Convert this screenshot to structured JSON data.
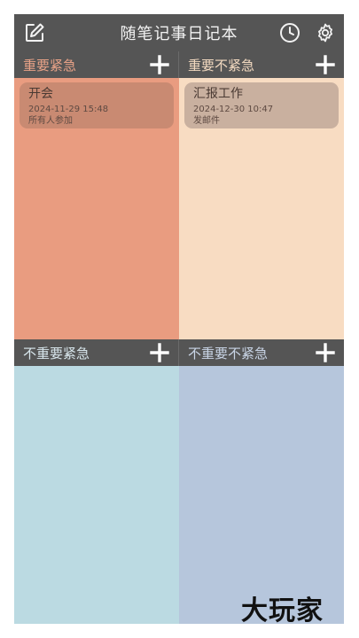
{
  "header": {
    "title": "随笔记事日记本",
    "left_icon": "edit-icon",
    "right_icons": [
      "clock-icon",
      "gear-icon"
    ]
  },
  "quadrants": [
    {
      "title": "重要紧急",
      "bg": "#e99c80",
      "title_color": "#e8a287",
      "cards": [
        {
          "title": "开会",
          "time": "2024-11-29 15:48",
          "note": "所有人参加",
          "bg": "#c98a72"
        }
      ]
    },
    {
      "title": "重要不紧急",
      "bg": "#f8dcc2",
      "title_color": "#f2d9c0",
      "cards": [
        {
          "title": "汇报工作",
          "time": "2024-12-30 10:47",
          "note": "发邮件",
          "bg": "#c9b09f"
        }
      ]
    },
    {
      "title": "不重要紧急",
      "bg": "#bbdae2",
      "title_color": "#d8e6ec",
      "cards": []
    },
    {
      "title": "不重要不紧急",
      "bg": "#b6c6dc",
      "title_color": "#c9d5e6",
      "cards": []
    }
  ],
  "watermark": "大玩家"
}
